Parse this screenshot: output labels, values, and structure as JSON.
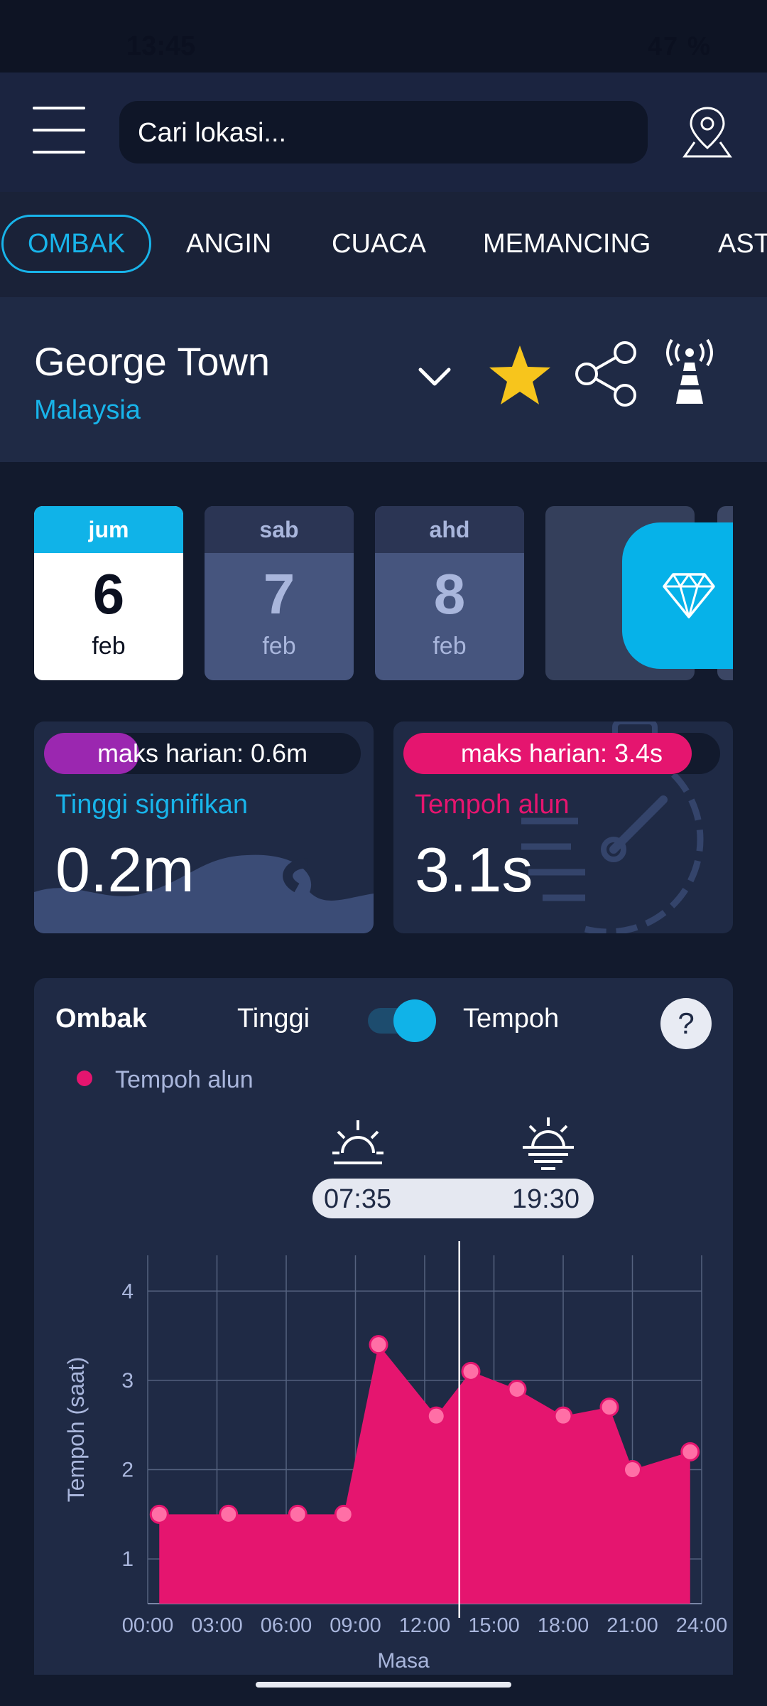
{
  "status_bar": {
    "time": "13:45",
    "battery": "47 %"
  },
  "search": {
    "placeholder": "Cari lokasi..."
  },
  "tabs": [
    "OMBAK",
    "ANGIN",
    "CUACA",
    "MEMANCING",
    "AST"
  ],
  "location": {
    "city": "George Town",
    "country": "Malaysia"
  },
  "days": [
    {
      "dow": "jum",
      "day": "6",
      "month": "feb"
    },
    {
      "dow": "sab",
      "day": "7",
      "month": "feb"
    },
    {
      "dow": "ahd",
      "day": "8",
      "month": "feb"
    }
  ],
  "wave_height": {
    "daily_max": "maks harian: 0.6m",
    "daily_max_fraction": 0.3,
    "label": "Tinggi signifikan",
    "value": "0.2m"
  },
  "swell_period": {
    "daily_max": "maks harian: 3.4s",
    "daily_max_fraction": 0.91,
    "label": "Tempoh alun",
    "value": "3.1s"
  },
  "panel": {
    "title": "Ombak",
    "toggle_left": "Tinggi",
    "toggle_right": "Tempoh",
    "help": "?",
    "legend": "Tempoh alun",
    "sunrise": "07:35",
    "sunset": "19:30"
  },
  "colors": {
    "accent": "#18b4ea",
    "swell": "#e5156f",
    "wave_pill": "#9b27b0",
    "star": "#f7c51c"
  },
  "icons": [
    "menu-icon",
    "location-pin-icon",
    "chevron-down-icon",
    "star-icon",
    "share-icon",
    "tower-icon",
    "diamond-icon",
    "sunrise-icon",
    "sunset-icon",
    "help-icon"
  ],
  "chart_data": {
    "type": "area",
    "series": [
      {
        "name": "Tempoh alun",
        "x": [
          "00:30",
          "03:30",
          "06:30",
          "08:30",
          "10:00",
          "12:30",
          "14:00",
          "16:00",
          "18:00",
          "20:00",
          "21:00",
          "23:30"
        ],
        "values": [
          1.5,
          1.5,
          1.5,
          1.5,
          3.4,
          2.6,
          3.1,
          2.9,
          2.6,
          2.7,
          2.0,
          2.2
        ]
      }
    ],
    "x_ticks": [
      "00:00",
      "03:00",
      "06:00",
      "09:00",
      "12:00",
      "15:00",
      "18:00",
      "21:00",
      "24:00"
    ],
    "y_ticks": [
      "1",
      "2",
      "3",
      "4"
    ],
    "ylabel": "Tempoh (saat)",
    "xlabel": "Masa",
    "ylim": [
      0.5,
      4.4
    ],
    "xlim": [
      "00:00",
      "24:00"
    ],
    "grid": true,
    "current_time_marker": "13:30"
  }
}
